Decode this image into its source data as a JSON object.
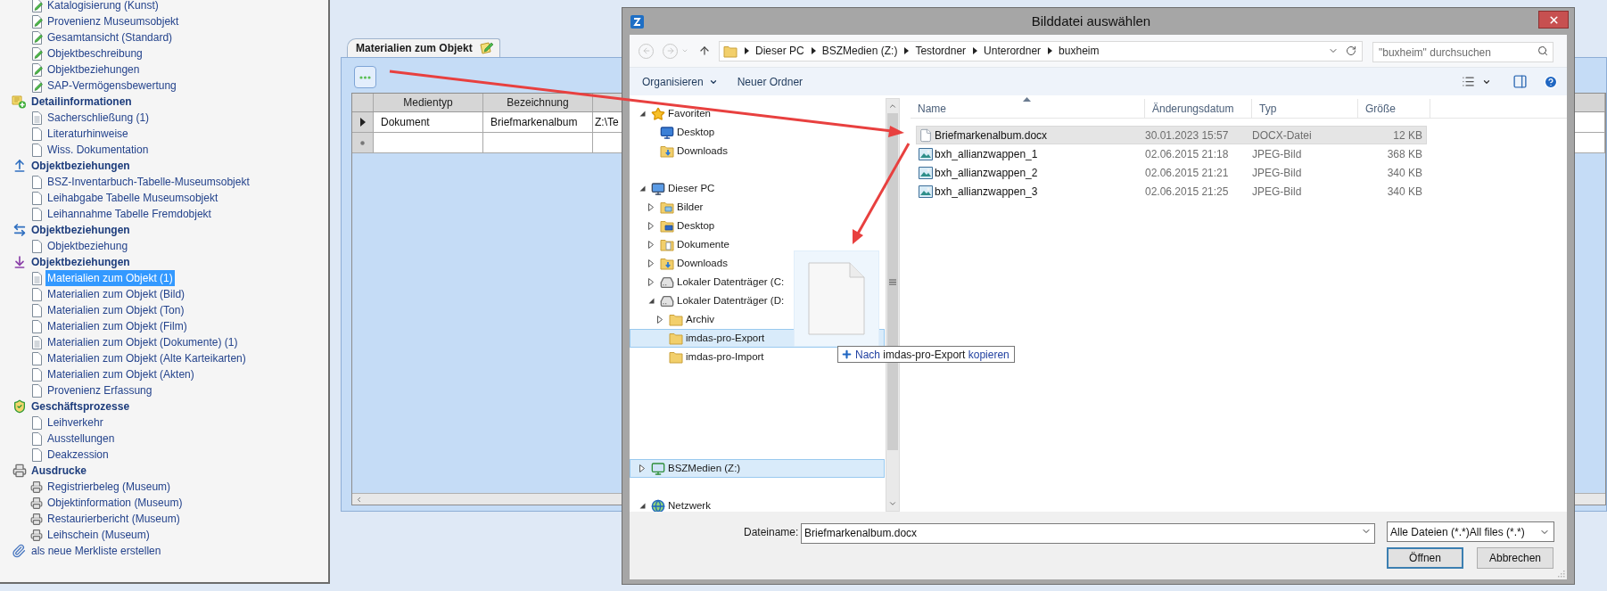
{
  "sidebar": {
    "groups": [
      {
        "items": [
          {
            "label": "Katalogisierung (Kunst)",
            "kind": "form",
            "selected": false
          },
          {
            "label": "Provenienz Museumsobjekt",
            "kind": "form",
            "selected": false
          },
          {
            "label": "Gesamtansicht (Standard)",
            "kind": "form",
            "selected": false
          },
          {
            "label": "Objektbeschreibung",
            "kind": "form",
            "selected": false
          },
          {
            "label": "Objektbeziehungen",
            "kind": "form",
            "selected": false
          },
          {
            "label": "SAP-Vermögensbewertung",
            "kind": "form",
            "selected": false
          }
        ]
      },
      {
        "title": "Detailinformationen",
        "kind": "details",
        "items": [
          {
            "label": "Sacherschließung (1)",
            "kind": "document",
            "selected": false
          },
          {
            "label": "Literaturhinweise",
            "kind": "page",
            "selected": false
          },
          {
            "label": "Wiss. Dokumentation",
            "kind": "page",
            "selected": false
          }
        ]
      },
      {
        "title": "Objektbeziehungen",
        "kind": "relations-up",
        "items": [
          {
            "label": "BSZ-Inventarbuch-Tabelle-Museumsobjekt",
            "kind": "page",
            "selected": false
          },
          {
            "label": "Leihabgabe Tabelle Museumsobjekt",
            "kind": "page",
            "selected": false
          },
          {
            "label": "Leihannahme Tabelle Fremdobjekt",
            "kind": "page",
            "selected": false
          }
        ]
      },
      {
        "title": "Objektbeziehungen",
        "kind": "relations-swap",
        "items": [
          {
            "label": "Objektbeziehung",
            "kind": "page",
            "selected": false
          }
        ]
      },
      {
        "title": "Objektbeziehungen",
        "kind": "relations-down",
        "items": [
          {
            "label": "Materialien zum Objekt (1)",
            "kind": "document",
            "selected": true
          },
          {
            "label": "Materialien zum Objekt (Bild)",
            "kind": "page",
            "selected": false
          },
          {
            "label": "Materialien zum Objekt (Ton)",
            "kind": "page",
            "selected": false
          },
          {
            "label": "Materialien zum Objekt (Film)",
            "kind": "page",
            "selected": false
          },
          {
            "label": "Materialien zum Objekt (Dokumente) (1)",
            "kind": "document",
            "selected": false
          },
          {
            "label": "Materialien zum Objekt (Alte Karteikarten)",
            "kind": "page",
            "selected": false
          },
          {
            "label": "Materialien zum Objekt (Akten)",
            "kind": "page",
            "selected": false
          },
          {
            "label": "Provenienz Erfassung",
            "kind": "page",
            "selected": false
          }
        ]
      },
      {
        "title": "Geschäftsprozesse",
        "kind": "processes",
        "items": [
          {
            "label": "Leihverkehr",
            "kind": "page",
            "selected": false
          },
          {
            "label": "Ausstellungen",
            "kind": "page",
            "selected": false
          },
          {
            "label": "Deakzession",
            "kind": "page",
            "selected": false
          }
        ]
      },
      {
        "title": "Ausdrucke",
        "kind": "prints",
        "items": [
          {
            "label": "Registrierbeleg (Museum)",
            "kind": "print",
            "selected": false
          },
          {
            "label": "Objektinformation (Museum)",
            "kind": "print",
            "selected": false
          },
          {
            "label": "Restaurierbericht (Museum)",
            "kind": "print",
            "selected": false
          },
          {
            "label": "Leihschein (Museum)",
            "kind": "print",
            "selected": false
          }
        ]
      }
    ],
    "action": "als neue Merkliste erstellen"
  },
  "editor": {
    "tab": {
      "label": "Materialien zum Objekt"
    },
    "table": {
      "columns": [
        "Medientyp",
        "Bezeichnung"
      ],
      "rows": [
        {
          "kind": "current",
          "cells": [
            "Dokument",
            "Briefmarkenalbum",
            "Z:\\Te"
          ]
        },
        {
          "kind": "new",
          "cells": []
        }
      ]
    }
  },
  "dialog": {
    "title": "Bilddatei auswählen",
    "breadcrumb": [
      "Dieser PC",
      "BSZMedien (Z:)",
      "Testordner",
      "Unterordner",
      "buxheim"
    ],
    "search": {
      "placeholder": "\"buxheim\" durchsuchen"
    },
    "toolbar": [
      {
        "label": "Organisieren",
        "kind": "menu"
      },
      {
        "label": "Neuer Ordner",
        "kind": "button"
      }
    ],
    "tree": [
      {
        "label": "Favoriten",
        "kind": "favorites",
        "expanded": true,
        "selected": false,
        "children": [
          {
            "label": "Desktop",
            "kind": "desktop",
            "selected": false
          },
          {
            "label": "Downloads",
            "kind": "downloads",
            "selected": false
          }
        ]
      },
      {
        "label": "Dieser PC",
        "kind": "pc",
        "expanded": true,
        "selected": false,
        "children": [
          {
            "label": "Bilder",
            "kind": "pictures",
            "expanded": false,
            "selected": false
          },
          {
            "label": "Desktop",
            "kind": "desktop-folder",
            "expanded": false,
            "selected": false
          },
          {
            "label": "Dokumente",
            "kind": "documents",
            "expanded": false,
            "selected": false
          },
          {
            "label": "Downloads",
            "kind": "downloads",
            "expanded": false,
            "selected": false
          },
          {
            "label": "Lokaler Datenträger (C:",
            "kind": "drive",
            "expanded": false,
            "selected": false
          },
          {
            "label": "Lokaler Datenträger (D:",
            "kind": "drive",
            "expanded": true,
            "selected": false,
            "children": [
              {
                "label": "Archiv",
                "kind": "folder",
                "expanded": false,
                "selected": false
              },
              {
                "label": "imdas-pro-Export",
                "kind": "folder",
                "selected": true
              },
              {
                "label": "imdas-pro-Import",
                "kind": "folder",
                "selected": false
              }
            ]
          }
        ]
      },
      {
        "label": "BSZMedien (Z:)",
        "kind": "network-drive",
        "expanded": false,
        "selected": true
      },
      {
        "label": "Netzwerk",
        "kind": "network",
        "expanded": true,
        "selected": false
      }
    ],
    "files": {
      "columns": [
        "Name",
        "Änderungsdatum",
        "Typ",
        "Größe"
      ],
      "rows": [
        {
          "name": "Briefmarkenalbum.docx",
          "date": "30.01.2023 15:57",
          "type": "DOCX-Datei",
          "size": "12 KB",
          "kind": "document",
          "selected": true
        },
        {
          "name": "bxh_allianzwappen_1",
          "date": "02.06.2015 21:18",
          "type": "JPEG-Bild",
          "size": "368 KB",
          "kind": "image",
          "selected": false
        },
        {
          "name": "bxh_allianzwappen_2",
          "date": "02.06.2015 21:21",
          "type": "JPEG-Bild",
          "size": "340 KB",
          "kind": "image",
          "selected": false
        },
        {
          "name": "bxh_allianzwappen_3",
          "date": "02.06.2015 21:25",
          "type": "JPEG-Bild",
          "size": "340 KB",
          "kind": "image",
          "selected": false
        }
      ]
    },
    "filename": {
      "label": "Dateiname:",
      "value": "Briefmarkenalbum.docx"
    },
    "filter": "Alle Dateien (*.*)All files (*.*)",
    "buttons": [
      {
        "label": "Öffnen",
        "default": true
      },
      {
        "label": "Abbrechen",
        "default": false
      }
    ],
    "drag_tooltip": {
      "verb": "Nach",
      "target": "imdas-pro-Export",
      "action": "kopieren"
    }
  }
}
